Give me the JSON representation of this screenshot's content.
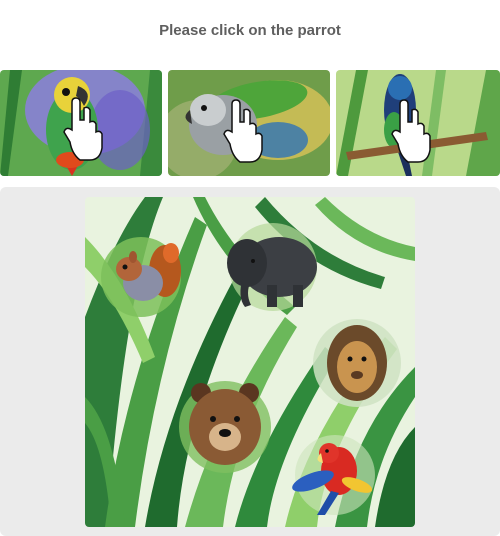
{
  "prompt": {
    "text": "Please click on the parrot"
  },
  "examples": [
    {
      "subject": "parrot"
    },
    {
      "subject": "parrot"
    },
    {
      "subject": "parrot"
    }
  ],
  "scene": {
    "background": "grass",
    "animals": [
      "squirrel",
      "elephant",
      "lion",
      "bear",
      "parrot"
    ]
  },
  "colors": {
    "title": "#5f5f5f",
    "panel": "#ebebeb",
    "grass_dark": "#1f6b2e",
    "grass_light": "#8fcf6a"
  }
}
